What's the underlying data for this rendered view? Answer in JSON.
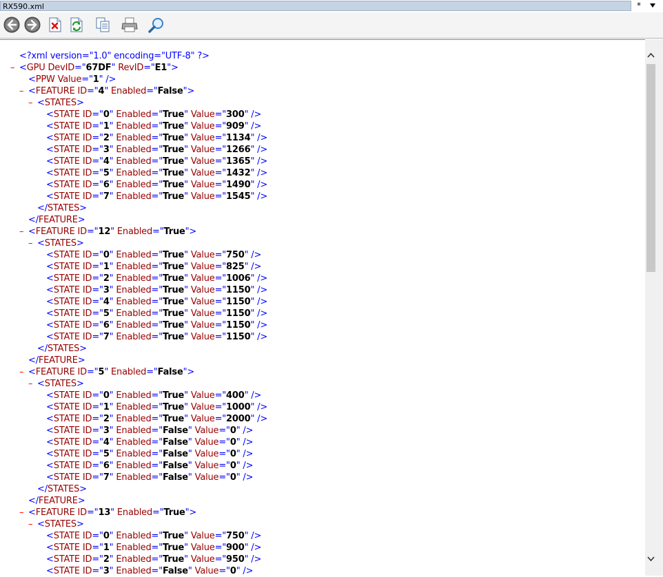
{
  "window": {
    "title": "RX590.xml",
    "ctrl_symbol": "*"
  },
  "toolbar": {
    "buttons": [
      {
        "name": "back-button",
        "icon": "back-arrow-icon"
      },
      {
        "name": "forward-button",
        "icon": "forward-arrow-icon"
      },
      {
        "name": "stop-button",
        "icon": "stop-icon"
      },
      {
        "name": "refresh-button",
        "icon": "refresh-icon"
      },
      {
        "name": "copy-button",
        "icon": "copy-icon"
      },
      {
        "name": "print-button",
        "icon": "printer-icon"
      },
      {
        "name": "find-button",
        "icon": "search-icon"
      }
    ]
  },
  "colors": {
    "tag": "#990000",
    "bracket": "#0000ff",
    "minus": "#ff0000",
    "value": "#000000",
    "title_bg": "#c5d3e3"
  },
  "xml": {
    "declaration": "<?xml version=\"1.0\" encoding=\"UTF-8\" ?>",
    "gpu": {
      "DevID": "67DF",
      "RevID": "E1"
    },
    "ppw": {
      "Value": "1"
    },
    "features": [
      {
        "ID": "4",
        "Enabled": "False",
        "states": [
          {
            "ID": "0",
            "Enabled": "True",
            "Value": "300"
          },
          {
            "ID": "1",
            "Enabled": "True",
            "Value": "909"
          },
          {
            "ID": "2",
            "Enabled": "True",
            "Value": "1134"
          },
          {
            "ID": "3",
            "Enabled": "True",
            "Value": "1266"
          },
          {
            "ID": "4",
            "Enabled": "True",
            "Value": "1365"
          },
          {
            "ID": "5",
            "Enabled": "True",
            "Value": "1432"
          },
          {
            "ID": "6",
            "Enabled": "True",
            "Value": "1490"
          },
          {
            "ID": "7",
            "Enabled": "True",
            "Value": "1545"
          }
        ]
      },
      {
        "ID": "12",
        "Enabled": "True",
        "states": [
          {
            "ID": "0",
            "Enabled": "True",
            "Value": "750"
          },
          {
            "ID": "1",
            "Enabled": "True",
            "Value": "825"
          },
          {
            "ID": "2",
            "Enabled": "True",
            "Value": "1006"
          },
          {
            "ID": "3",
            "Enabled": "True",
            "Value": "1150"
          },
          {
            "ID": "4",
            "Enabled": "True",
            "Value": "1150"
          },
          {
            "ID": "5",
            "Enabled": "True",
            "Value": "1150"
          },
          {
            "ID": "6",
            "Enabled": "True",
            "Value": "1150"
          },
          {
            "ID": "7",
            "Enabled": "True",
            "Value": "1150"
          }
        ]
      },
      {
        "ID": "5",
        "Enabled": "False",
        "states": [
          {
            "ID": "0",
            "Enabled": "True",
            "Value": "400"
          },
          {
            "ID": "1",
            "Enabled": "True",
            "Value": "1000"
          },
          {
            "ID": "2",
            "Enabled": "True",
            "Value": "2000"
          },
          {
            "ID": "3",
            "Enabled": "False",
            "Value": "0"
          },
          {
            "ID": "4",
            "Enabled": "False",
            "Value": "0"
          },
          {
            "ID": "5",
            "Enabled": "False",
            "Value": "0"
          },
          {
            "ID": "6",
            "Enabled": "False",
            "Value": "0"
          },
          {
            "ID": "7",
            "Enabled": "False",
            "Value": "0"
          }
        ]
      },
      {
        "ID": "13",
        "Enabled": "True",
        "states": [
          {
            "ID": "0",
            "Enabled": "True",
            "Value": "750"
          },
          {
            "ID": "1",
            "Enabled": "True",
            "Value": "900"
          },
          {
            "ID": "2",
            "Enabled": "True",
            "Value": "950"
          },
          {
            "ID": "3",
            "Enabled": "False",
            "Value": "0"
          }
        ]
      }
    ]
  }
}
